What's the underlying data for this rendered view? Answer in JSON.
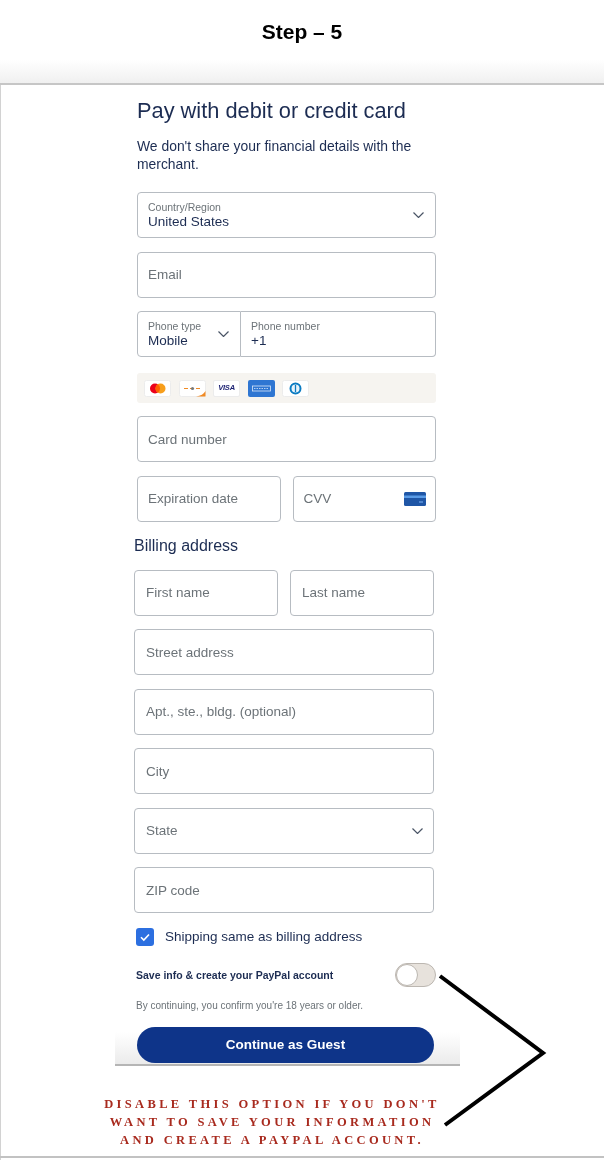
{
  "header": {
    "title": "Step – 5"
  },
  "form": {
    "title": "Pay with debit or credit card",
    "subtitle": "We don't share your financial details with the merchant.",
    "contact_rows": [
      {
        "fields": [
          {
            "kind": "select",
            "label": "Country/Region",
            "value": "United States"
          }
        ]
      },
      {
        "fields": [
          {
            "kind": "text",
            "placeholder": "Email"
          }
        ]
      },
      {
        "joined": true,
        "fields": [
          {
            "kind": "select",
            "label": "Phone type",
            "value": "Mobile"
          },
          {
            "kind": "text",
            "label": "Phone number",
            "value": "+1"
          }
        ]
      }
    ],
    "card_logos": [
      {
        "kind": "circles"
      },
      {
        "kind": "dash"
      },
      {
        "kind": "wordmark",
        "text": "VISA"
      },
      {
        "kind": "tile"
      },
      {
        "kind": "ring"
      }
    ],
    "card_rows": [
      {
        "fields": [
          {
            "kind": "text",
            "placeholder": "Card number"
          }
        ]
      },
      {
        "fields": [
          {
            "kind": "text",
            "placeholder": "Expiration date"
          },
          {
            "kind": "card_code",
            "placeholder": "CVV"
          }
        ]
      }
    ],
    "billing": {
      "title": "Billing address",
      "rows": [
        {
          "fields": [
            {
              "kind": "text",
              "placeholder": "First name"
            },
            {
              "kind": "text",
              "placeholder": "Last name"
            }
          ]
        },
        {
          "fields": [
            {
              "kind": "text",
              "placeholder": "Street address"
            }
          ]
        },
        {
          "fields": [
            {
              "kind": "text",
              "placeholder": "Apt., ste., bldg. (optional)"
            }
          ]
        },
        {
          "fields": [
            {
              "kind": "text",
              "placeholder": "City"
            }
          ]
        },
        {
          "fields": [
            {
              "kind": "select",
              "placeholder": "State"
            }
          ]
        },
        {
          "fields": [
            {
              "kind": "text",
              "placeholder": "ZIP code"
            }
          ]
        }
      ]
    },
    "shipping_same": {
      "label": "Shipping same as billing address",
      "checked": true
    },
    "save_account": {
      "label": "Save info & create your PayPal account",
      "on": false
    },
    "notice": "By continuing, you confirm you're 18 years or older.",
    "continue_button": "Continue as Guest"
  },
  "annotation": {
    "lines": [
      "DISABLE THIS OPTION IF YOU DON'T",
      "WANT TO SAVE YOUR INFORMATION",
      "AND CREATE A PAYPAL ACCOUNT."
    ]
  }
}
